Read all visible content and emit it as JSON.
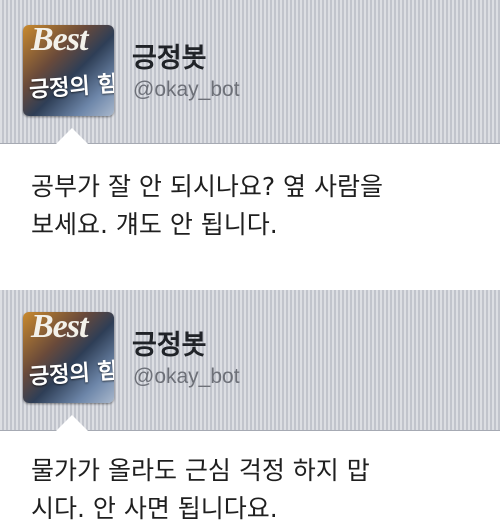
{
  "tweets": [
    {
      "name": "긍정봇",
      "handle": "@okay_bot",
      "avatar_text_top": "Best",
      "avatar_text_bottom": "긍정의 힘",
      "text": "공부가 잘 안 되시나요? 옆 사람을\n보세요. 걔도 안 됩니다."
    },
    {
      "name": "긍정봇",
      "handle": "@okay_bot",
      "avatar_text_top": "Best",
      "avatar_text_bottom": "긍정의 힘",
      "text": "물가가 올라도 근심 걱정 하지 맙\n시다. 안 사면 됩니다요."
    }
  ],
  "colors": {
    "header_bg": "#c9ccd4",
    "handle": "#6d7078",
    "text": "#1f1f1f"
  }
}
